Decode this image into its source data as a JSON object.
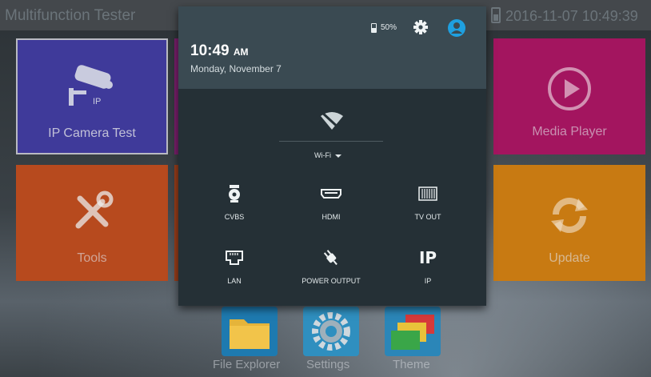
{
  "status_bar": {
    "app_title": "Multifunction Tester",
    "datetime": "2016-11-07 10:49:39",
    "battery_icon": "battery-icon"
  },
  "tiles": [
    {
      "label": "IP Camera Test",
      "icon": "ip-camera-icon",
      "color": "#3f3a9a"
    },
    {
      "label": "Tools",
      "icon": "tools-icon",
      "color": "#b74a1e"
    },
    {
      "label": "Media Player",
      "icon": "play-icon",
      "color": "#a3155f"
    },
    {
      "label": "Update",
      "icon": "refresh-icon",
      "color": "#c87a12"
    }
  ],
  "dock": [
    {
      "label": "File Explorer",
      "icon": "folder-icon"
    },
    {
      "label": "Settings",
      "icon": "gear-icon"
    },
    {
      "label": "Theme",
      "icon": "theme-icon"
    }
  ],
  "notification_shade": {
    "battery_percent": "50%",
    "time": "10:49",
    "am_pm": "AM",
    "date": "Monday, November 7",
    "settings_icon": "gear-icon",
    "user_icon": "account-icon",
    "wifi": {
      "label": "Wi-Fi",
      "icon": "wifi-off-icon"
    },
    "quick_settings": [
      {
        "label": "CVBS",
        "icon": "cctv-camera-icon"
      },
      {
        "label": "HDMI",
        "icon": "hdmi-icon"
      },
      {
        "label": "TV OUT",
        "icon": "tv-out-icon"
      },
      {
        "label": "LAN",
        "icon": "lan-port-icon"
      },
      {
        "label": "POWER OUTPUT",
        "icon": "power-plug-icon"
      },
      {
        "label": "IP",
        "icon": "ip-icon",
        "glyph": "IP"
      }
    ]
  }
}
